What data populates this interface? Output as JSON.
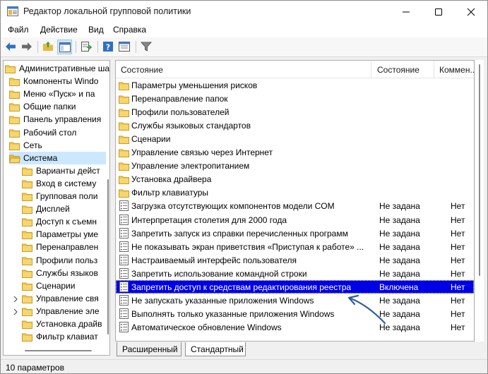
{
  "window": {
    "title": "Редактор локальной групповой политики"
  },
  "menu": [
    "Файл",
    "Действие",
    "Вид",
    "Справка"
  ],
  "tree": {
    "items": [
      {
        "label": "Административные ша",
        "level": 0,
        "icon": "folder-icon",
        "selected": false
      },
      {
        "label": "Компоненты Windo",
        "level": 1,
        "icon": "folder-icon",
        "selected": false
      },
      {
        "label": "Меню «Пуск» и па",
        "level": 1,
        "icon": "folder-icon",
        "selected": false
      },
      {
        "label": "Общие папки",
        "level": 1,
        "icon": "folder-icon",
        "selected": false
      },
      {
        "label": "Панель управления",
        "level": 1,
        "icon": "folder-icon",
        "selected": false
      },
      {
        "label": "Рабочий стол",
        "level": 1,
        "icon": "folder-icon",
        "selected": false
      },
      {
        "label": "Сеть",
        "level": 1,
        "icon": "folder-icon",
        "selected": false
      },
      {
        "label": "Система",
        "level": 1,
        "icon": "folder-open-icon",
        "selected": true
      },
      {
        "label": "Варианты дейст",
        "level": 2,
        "icon": "folder-icon",
        "selected": false
      },
      {
        "label": "Вход в систему",
        "level": 2,
        "icon": "folder-icon",
        "selected": false
      },
      {
        "label": "Групповая поли",
        "level": 2,
        "icon": "folder-icon",
        "selected": false
      },
      {
        "label": "Дисплей",
        "level": 2,
        "icon": "folder-icon",
        "selected": false
      },
      {
        "label": "Доступ к съемн",
        "level": 2,
        "icon": "folder-icon",
        "selected": false
      },
      {
        "label": "Параметры уме",
        "level": 2,
        "icon": "folder-icon",
        "selected": false
      },
      {
        "label": "Перенаправлен",
        "level": 2,
        "icon": "folder-icon",
        "selected": false
      },
      {
        "label": "Профили польз",
        "level": 2,
        "icon": "folder-icon",
        "selected": false
      },
      {
        "label": "Службы языков",
        "level": 2,
        "icon": "folder-icon",
        "selected": false
      },
      {
        "label": "Сценарии",
        "level": 2,
        "icon": "folder-icon",
        "selected": false
      },
      {
        "label": "Управление свя",
        "level": 2,
        "icon": "folder-icon",
        "selected": false,
        "expander": true
      },
      {
        "label": "Управление эле",
        "level": 2,
        "icon": "folder-icon",
        "selected": false,
        "expander": true
      },
      {
        "label": "Установка драйв",
        "level": 2,
        "icon": "folder-icon",
        "selected": false
      },
      {
        "label": "Фильтр клавиат",
        "level": 2,
        "icon": "folder-icon",
        "selected": false
      }
    ]
  },
  "list": {
    "columns": [
      "Состояние",
      "Состояние",
      "Коммен..."
    ],
    "rows": [
      {
        "name": "Параметры уменьшения рисков",
        "state": "",
        "comment": "",
        "type": "folder"
      },
      {
        "name": "Перенаправление папок",
        "state": "",
        "comment": "",
        "type": "folder"
      },
      {
        "name": "Профили пользователей",
        "state": "",
        "comment": "",
        "type": "folder"
      },
      {
        "name": "Службы языковых стандартов",
        "state": "",
        "comment": "",
        "type": "folder"
      },
      {
        "name": "Сценарии",
        "state": "",
        "comment": "",
        "type": "folder"
      },
      {
        "name": "Управление связью через Интернет",
        "state": "",
        "comment": "",
        "type": "folder"
      },
      {
        "name": "Управление электропитанием",
        "state": "",
        "comment": "",
        "type": "folder"
      },
      {
        "name": "Установка драйвера",
        "state": "",
        "comment": "",
        "type": "folder"
      },
      {
        "name": "Фильтр клавиатуры",
        "state": "",
        "comment": "",
        "type": "folder"
      },
      {
        "name": "Загрузка отсутствующих компонентов модели COM",
        "state": "Не задана",
        "comment": "Нет",
        "type": "policy"
      },
      {
        "name": "Интерпретация столетия для 2000 года",
        "state": "Не задана",
        "comment": "Нет",
        "type": "policy"
      },
      {
        "name": "Запретить запуск из справки перечисленных программ",
        "state": "Не задана",
        "comment": "Нет",
        "type": "policy"
      },
      {
        "name": "Не показывать экран приветствия «Приступая к работе» ...",
        "state": "Не задана",
        "comment": "Нет",
        "type": "policy"
      },
      {
        "name": "Настраиваемый интерфейс пользователя",
        "state": "Не задана",
        "comment": "Нет",
        "type": "policy"
      },
      {
        "name": "Запретить использование командной строки",
        "state": "Не задана",
        "comment": "Нет",
        "type": "policy"
      },
      {
        "name": "Запретить доступ к средствам редактирования реестра",
        "state": "Включена",
        "comment": "Нет",
        "type": "policy",
        "selected": true
      },
      {
        "name": "Не запускать указанные приложения Windows",
        "state": "Не задана",
        "comment": "Нет",
        "type": "policy"
      },
      {
        "name": "Выполнять только указанные приложения Windows",
        "state": "Не задана",
        "comment": "Нет",
        "type": "policy"
      },
      {
        "name": "Автоматическое обновление Windows",
        "state": "Не задана",
        "comment": "Нет",
        "type": "policy"
      }
    ]
  },
  "tabs": [
    "Расширенный",
    "Стандартный"
  ],
  "status": "10 параметров",
  "colors": {
    "selection": "#0000e6",
    "tree_selection": "#cce8ff",
    "arrow": "#2f5fa0",
    "folder": "#e8b93e"
  }
}
